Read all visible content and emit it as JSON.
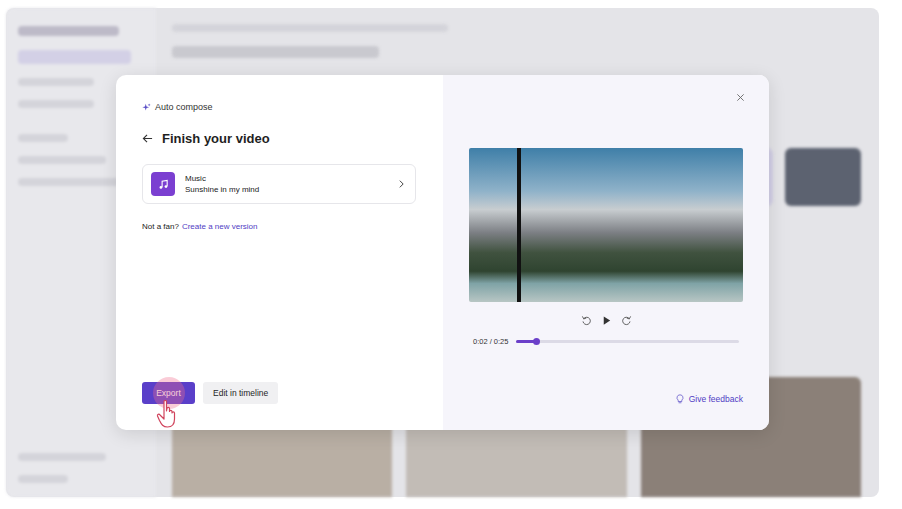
{
  "dialog": {
    "breadcrumb": "Auto compose",
    "title": "Finish your video"
  },
  "music": {
    "label": "Music",
    "track": "Sunshine in my mind"
  },
  "prompt": {
    "text": "Not a fan?",
    "link": "Create a new version"
  },
  "buttons": [
    {
      "label": "Export",
      "kind": "primary",
      "pressed": true
    },
    {
      "label": "Edit in timeline",
      "kind": "secondary",
      "pressed": false
    }
  ],
  "player": {
    "time": "0:02 / 0:25",
    "level": 0.09,
    "playing": false
  },
  "feedback": {
    "label": "Give feedback"
  }
}
